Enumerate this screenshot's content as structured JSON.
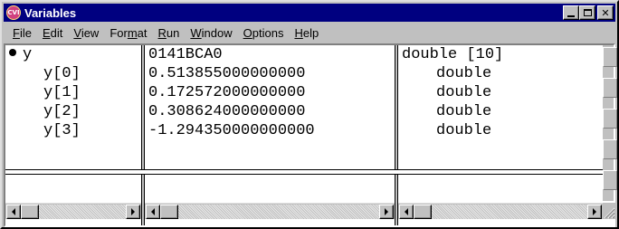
{
  "window": {
    "title": "Variables",
    "icon_name": "app-logo-icon",
    "icon_text": "CVI"
  },
  "menu": [
    {
      "key": "file",
      "label": "File",
      "accel": "F"
    },
    {
      "key": "edit",
      "label": "Edit",
      "accel": "E"
    },
    {
      "key": "view",
      "label": "View",
      "accel": "V"
    },
    {
      "key": "format",
      "label": "Format",
      "accel": "m"
    },
    {
      "key": "run",
      "label": "Run",
      "accel": "R"
    },
    {
      "key": "window",
      "label": "Window",
      "accel": "W"
    },
    {
      "key": "options",
      "label": "Options",
      "accel": "O"
    },
    {
      "key": "help",
      "label": "Help",
      "accel": "H"
    }
  ],
  "variables": {
    "parent": {
      "name": "y",
      "value": "0141BCA0",
      "type": "double [10]"
    },
    "children": [
      {
        "name": "y[0]",
        "value": "0.513855000000000",
        "type": "double"
      },
      {
        "name": "y[1]",
        "value": "0.172572000000000",
        "type": "double"
      },
      {
        "name": "y[2]",
        "value": "0.308624000000000",
        "type": "double"
      },
      {
        "name": "y[3]",
        "value": "-1.294350000000000",
        "type": "double"
      }
    ]
  },
  "colors": {
    "titlebar": "#000080",
    "window_face": "#c0c0c0"
  }
}
